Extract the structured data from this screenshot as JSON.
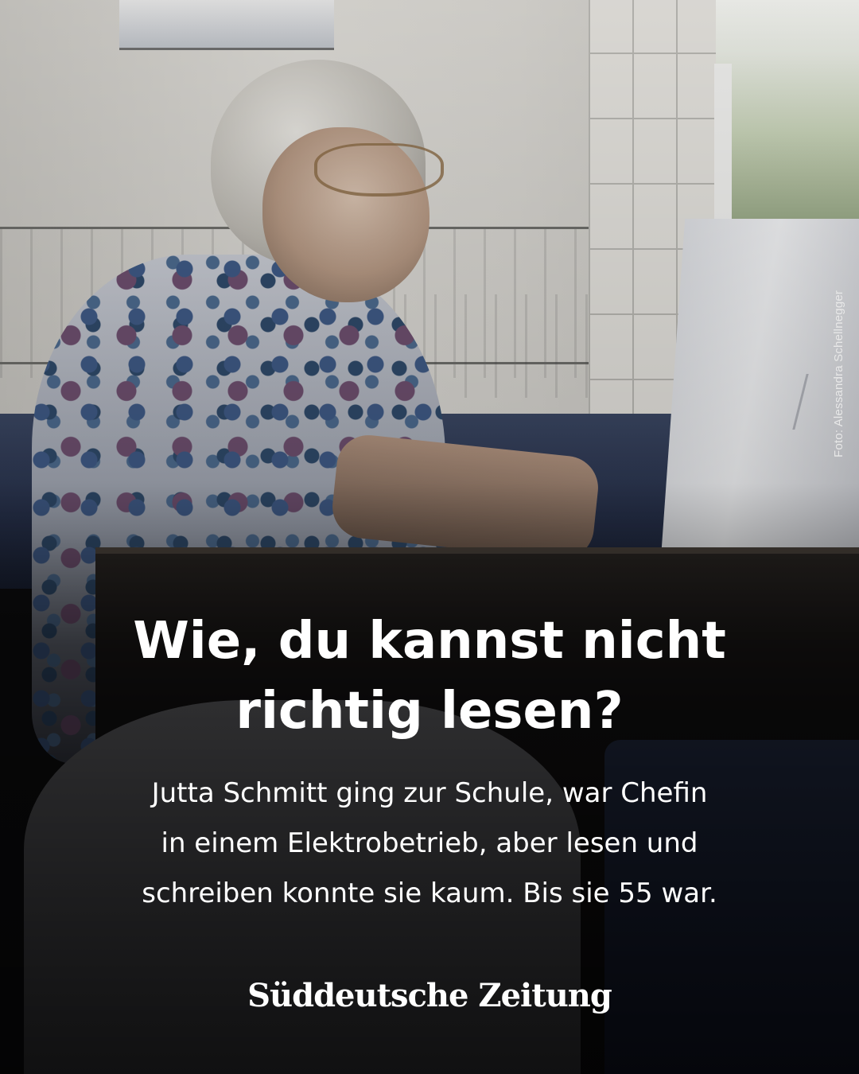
{
  "post": {
    "headline_line1": "Wie, du kannst nicht",
    "headline_line2": "richtig lesen?",
    "subline_line1": "Jutta Schmitt ging zur Schule, war Chefin",
    "subline_line2": "in einem Elektrobetrieb, aber lesen und",
    "subline_line3": "schreiben konnte sie kaum. Bis sie 55 war.",
    "photo_credit": "Foto: Alessandra Schellnegger",
    "brand": "Süddeutsche Zeitung"
  },
  "colors": {
    "text": "#ffffff",
    "shade": "#000000"
  }
}
